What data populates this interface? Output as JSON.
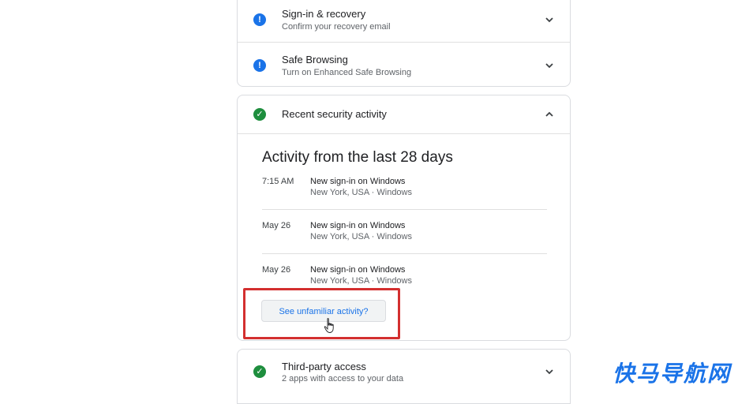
{
  "sections": {
    "signin": {
      "title": "Sign-in & recovery",
      "subtitle": "Confirm your recovery email",
      "icon": "alert-info-icon"
    },
    "safe_browsing": {
      "title": "Safe Browsing",
      "subtitle": "Turn on Enhanced Safe Browsing",
      "icon": "alert-info-icon"
    },
    "recent_activity": {
      "title": "Recent security activity",
      "icon": "check-circle-icon"
    },
    "third_party": {
      "title": "Third-party access",
      "subtitle": "2 apps with access to your data",
      "icon": "check-circle-icon"
    }
  },
  "activity": {
    "heading": "Activity from the last 28 days",
    "items": [
      {
        "time": "7:15 AM",
        "title": "New sign-in on Windows",
        "location": "New York, USA · Windows"
      },
      {
        "time": "May 26",
        "title": "New sign-in on Windows",
        "location": "New York, USA · Windows"
      },
      {
        "time": "May 26",
        "title": "New sign-in on Windows",
        "location": "New York, USA · Windows"
      }
    ],
    "button_label": "See unfamiliar activity?"
  },
  "watermark": "快马导航网",
  "colors": {
    "warning_blue": "#1a73e8",
    "success_green": "#1e8e3e",
    "highlight_red": "#d32f2f",
    "watermark": "#1a73e8"
  }
}
